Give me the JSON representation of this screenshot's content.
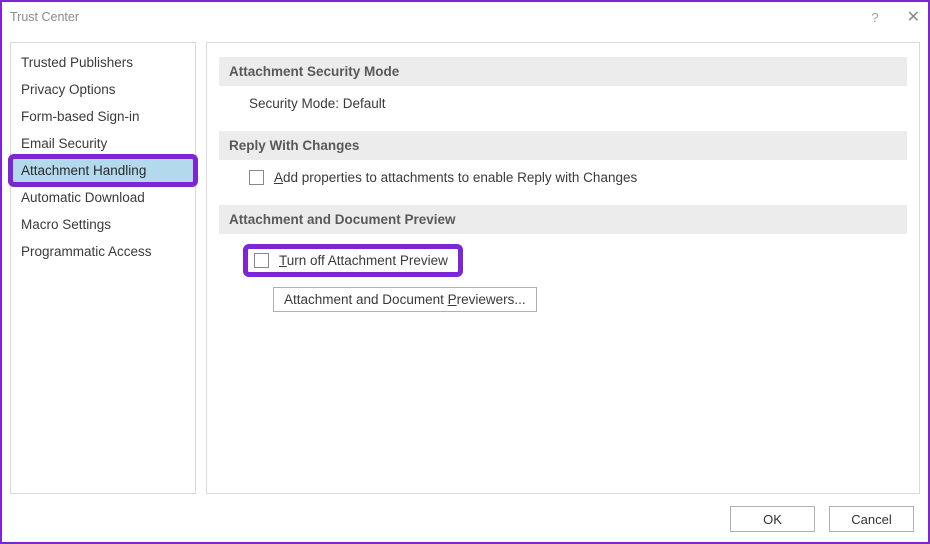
{
  "title": "Trust Center",
  "help_label": "?",
  "close_label": "✕",
  "sidebar": {
    "items": [
      {
        "label": "Trusted Publishers",
        "selected": false
      },
      {
        "label": "Privacy Options",
        "selected": false
      },
      {
        "label": "Form-based Sign-in",
        "selected": false
      },
      {
        "label": "Email Security",
        "selected": false
      },
      {
        "label": "Attachment Handling",
        "selected": true,
        "highlighted": true
      },
      {
        "label": "Automatic Download",
        "selected": false
      },
      {
        "label": "Macro Settings",
        "selected": false
      },
      {
        "label": "Programmatic Access",
        "selected": false
      }
    ]
  },
  "content": {
    "section1": {
      "header": "Attachment Security Mode",
      "line": "Security Mode: Default"
    },
    "section2": {
      "header": "Reply With Changes",
      "checkbox_label_prefix": "A",
      "checkbox_label_rest": "dd properties to attachments to enable Reply with Changes"
    },
    "section3": {
      "header": "Attachment and Document Preview",
      "checkbox_label_prefix": "T",
      "checkbox_label_rest": "urn off Attachment Preview",
      "button_prefix": "Attachment and Document ",
      "button_underline": "P",
      "button_rest": "reviewers..."
    }
  },
  "footer": {
    "ok": "OK",
    "cancel": "Cancel"
  }
}
